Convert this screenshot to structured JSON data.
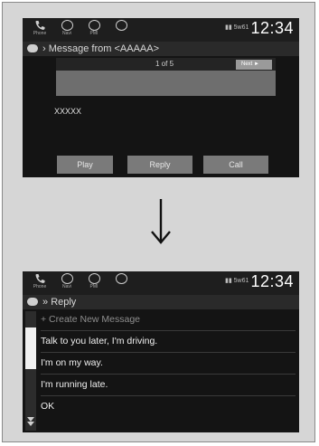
{
  "colors": {
    "screen_bg": "#141414",
    "button_gray": "#7a7a7a",
    "panel_gray": "#6e6e6e",
    "text_light": "#f0f0f0"
  },
  "statusbar": {
    "shortcuts": [
      {
        "label": "Phone",
        "icon": "phone-icon"
      },
      {
        "label": "Navi",
        "icon": "navi-icon"
      },
      {
        "label": "PMI",
        "icon": "person-icon"
      },
      {
        "label": "",
        "icon": "circle-icon"
      }
    ],
    "signal_text": "▮▮ 5w61",
    "time": "12:34"
  },
  "screen1": {
    "title": "Message from <AAAAA>",
    "pager": "1 of 5",
    "next_label": "Next",
    "message_body": "XXXXX",
    "buttons": {
      "play": "Play",
      "reply": "Reply",
      "call": "Call"
    }
  },
  "screen2": {
    "title": "Reply",
    "items": [
      "+ Create New Message",
      "Talk to you later, I'm driving.",
      "I'm on my way.",
      "I'm running late.",
      "OK"
    ]
  }
}
